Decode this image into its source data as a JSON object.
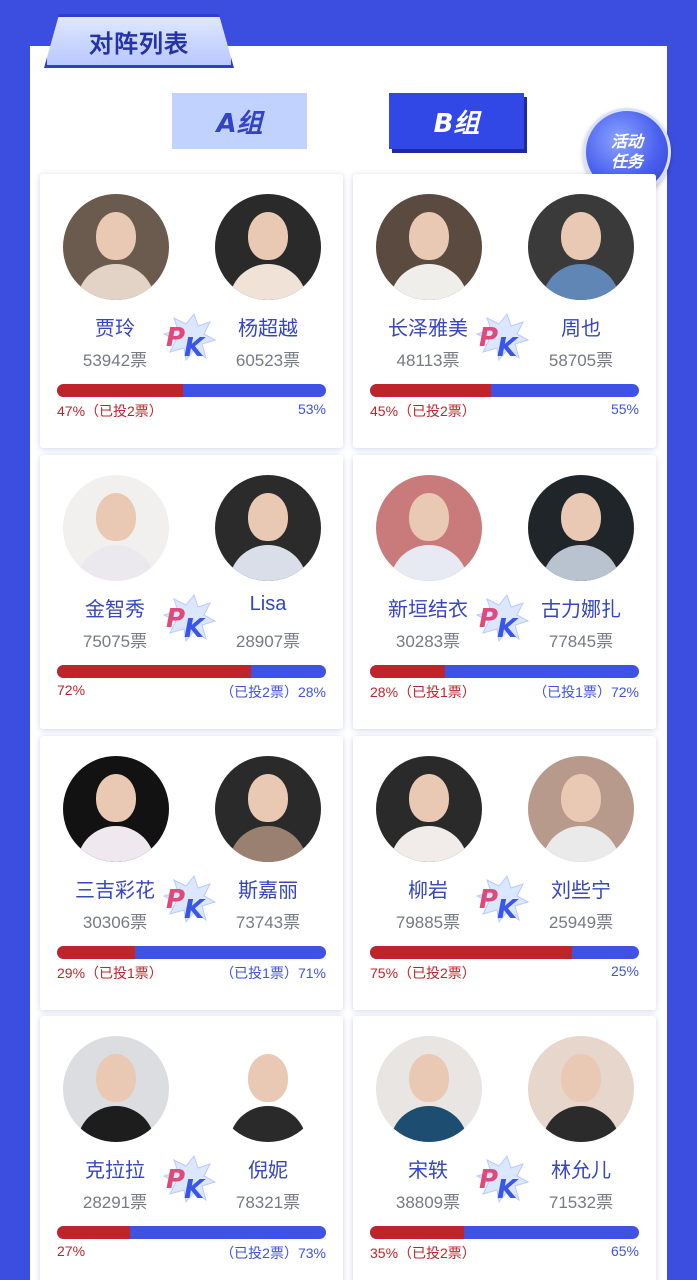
{
  "header": {
    "title": "对阵列表"
  },
  "tabs": [
    {
      "label": "A组",
      "active": false
    },
    {
      "label": "B组",
      "active": true
    }
  ],
  "activity_badge": {
    "line1": "活动",
    "line2": "任务"
  },
  "colors": {
    "accent": "#3b4ee0",
    "left_bar": "#c0242b",
    "right_bar": "#3f52e6"
  },
  "matches": [
    {
      "left": {
        "name": "贾玲",
        "votes": "53942票",
        "percent": "47%（已投2票）"
      },
      "right": {
        "name": "杨超越",
        "votes": "60523票",
        "percent": "53%"
      },
      "left_share": 0.47,
      "pk_icon": "pk-icon"
    },
    {
      "left": {
        "name": "长泽雅美",
        "votes": "48113票",
        "percent": "45%（已投2票）"
      },
      "right": {
        "name": "周也",
        "votes": "58705票",
        "percent": "55%"
      },
      "left_share": 0.45,
      "pk_icon": "pk-icon"
    },
    {
      "left": {
        "name": "金智秀",
        "votes": "75075票",
        "percent": "72%"
      },
      "right": {
        "name": "Lisa",
        "votes": "28907票",
        "percent": "（已投2票）28%"
      },
      "left_share": 0.72,
      "pk_icon": "pk-icon"
    },
    {
      "left": {
        "name": "新垣结衣",
        "votes": "30283票",
        "percent": "28%（已投1票）"
      },
      "right": {
        "name": "古力娜扎",
        "votes": "77845票",
        "percent": "（已投1票）72%"
      },
      "left_share": 0.28,
      "pk_icon": "pk-icon"
    },
    {
      "left": {
        "name": "三吉彩花",
        "votes": "30306票",
        "percent": "29%（已投1票）"
      },
      "right": {
        "name": "斯嘉丽",
        "votes": "73743票",
        "percent": "（已投1票）71%"
      },
      "left_share": 0.29,
      "pk_icon": "pk-icon"
    },
    {
      "left": {
        "name": "柳岩",
        "votes": "79885票",
        "percent": "75%（已投2票）"
      },
      "right": {
        "name": "刘些宁",
        "votes": "25949票",
        "percent": "25%"
      },
      "left_share": 0.75,
      "pk_icon": "pk-icon"
    },
    {
      "left": {
        "name": "克拉拉",
        "votes": "28291票",
        "percent": "27%"
      },
      "right": {
        "name": "倪妮",
        "votes": "78321票",
        "percent": "（已投2票）73%"
      },
      "left_share": 0.27,
      "pk_icon": "pk-icon"
    },
    {
      "left": {
        "name": "宋轶",
        "votes": "38809票",
        "percent": "35%（已投2票）"
      },
      "right": {
        "name": "林允儿",
        "votes": "71532票",
        "percent": "65%"
      },
      "left_share": 0.35,
      "pk_icon": "pk-icon"
    }
  ]
}
